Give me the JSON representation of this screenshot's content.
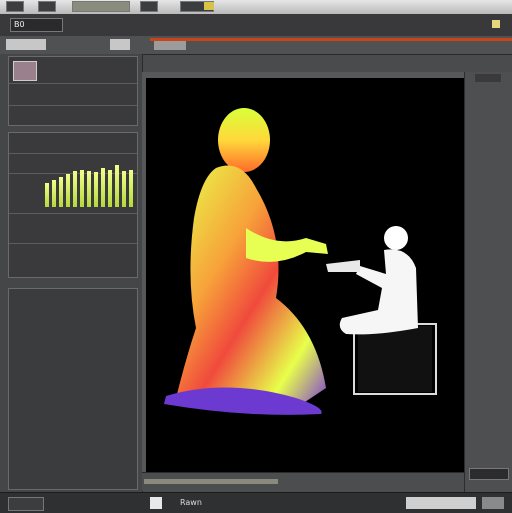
{
  "topbar": {
    "buttons": [
      "",
      "",
      "",
      "",
      ""
    ]
  },
  "menubar": {
    "title": "B0",
    "right_tag": "",
    "value": ""
  },
  "toolbar": {
    "field": "",
    "tools": [
      "",
      ""
    ]
  },
  "left_panel": {
    "labels": [
      "",
      ""
    ],
    "bars": [
      0.4,
      0.45,
      0.5,
      0.55,
      0.6,
      0.62,
      0.6,
      0.58,
      0.65,
      0.62,
      0.7,
      0.6,
      0.62
    ]
  },
  "bottom": {
    "left_label": "",
    "mid_label": "Rawn",
    "right_label": ""
  },
  "colors": {
    "accent": "#c8451c",
    "bars": "#d7f25a"
  }
}
